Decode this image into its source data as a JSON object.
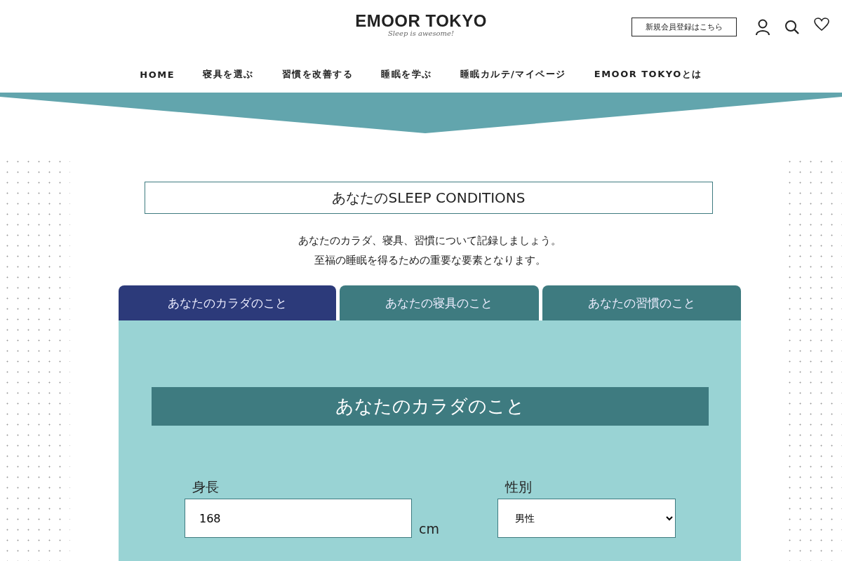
{
  "header": {
    "logo": "EMOOR TOKYO",
    "tagline": "Sleep is awesome!",
    "register_link": "新規会員登録はこちら"
  },
  "nav": [
    "HOME",
    "寝具を選ぶ",
    "習慣を改善する",
    "睡眠を学ぶ",
    "睡眠カルテ/マイページ",
    "EMOOR TOKYOとは"
  ],
  "title": "あなたのSLEEP CONDITIONS",
  "intro": [
    "あなたのカラダ、寝具、習慣について記録しましょう。",
    "至福の睡眠を得るための重要な要素となります。"
  ],
  "tabs": [
    {
      "label": "あなたのカラダのこと",
      "selected": true
    },
    {
      "label": "あなたの寝具のこと",
      "selected": false
    },
    {
      "label": "あなたの習慣のこと",
      "selected": false
    }
  ],
  "section_heading": "あなたのカラダのこと",
  "fields": [
    {
      "kind": "input",
      "label": "身長",
      "value": "168",
      "unit": "cm"
    },
    {
      "kind": "select",
      "label": "性別",
      "value": "男性"
    }
  ]
}
